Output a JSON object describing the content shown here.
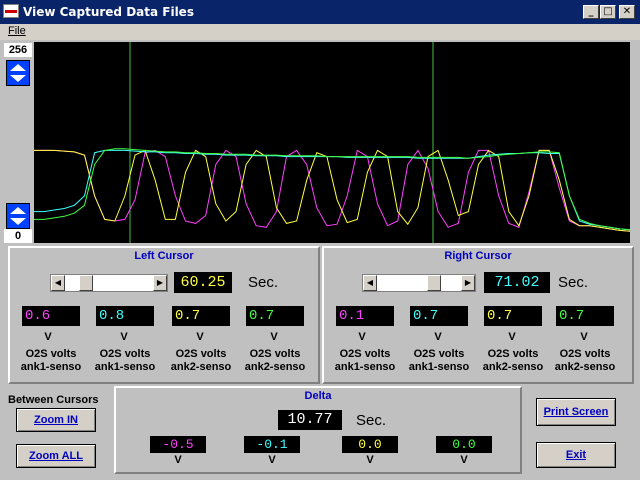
{
  "window": {
    "title": "View Captured Data Files",
    "buttons": {
      "minimize": "_",
      "maximize": "□",
      "close": "✕"
    }
  },
  "menu": {
    "file": "File"
  },
  "scale": {
    "max": "256",
    "min": "0"
  },
  "colors": {
    "sensor1": "#ff40ff",
    "sensor2": "#40ffff",
    "sensor3": "#ffff40",
    "sensor4": "#40ff40",
    "cursor": "#40c040"
  },
  "chart_data": {
    "type": "line",
    "ylim": [
      0,
      256
    ],
    "cursors": {
      "left": 60.25,
      "right": 71.02
    },
    "series": [
      {
        "color": "#ff40ff",
        "values": [
          118,
          118,
          118,
          117,
          116,
          112,
          60,
          30,
          28,
          30,
          55,
          115,
          118,
          110,
          60,
          28,
          25,
          35,
          100,
          118,
          110,
          50,
          22,
          20,
          40,
          110,
          118,
          100,
          45,
          22,
          24,
          60,
          118,
          110,
          50,
          22,
          28,
          100,
          118,
          95,
          40,
          20,
          25,
          90,
          118,
          118,
          60,
          25,
          20,
          65,
          118,
          118,
          70,
          28,
          22,
          22,
          20,
          18,
          16,
          15
        ]
      },
      {
        "color": "#ffff40",
        "values": [
          118,
          118,
          118,
          117,
          116,
          112,
          60,
          30,
          28,
          60,
          112,
          118,
          80,
          30,
          30,
          90,
          118,
          110,
          50,
          28,
          40,
          100,
          118,
          110,
          45,
          25,
          28,
          80,
          115,
          110,
          55,
          26,
          30,
          90,
          118,
          110,
          40,
          24,
          45,
          110,
          118,
          80,
          35,
          40,
          100,
          118,
          110,
          40,
          22,
          60,
          118,
          118,
          80,
          30,
          22,
          22,
          20,
          18,
          16,
          15
        ]
      },
      {
        "color": "#40ffff",
        "values": [
          40,
          40,
          42,
          44,
          48,
          60,
          115,
          118,
          118,
          118,
          117,
          116,
          116,
          115,
          115,
          114,
          114,
          113,
          113,
          112,
          112,
          112,
          111,
          111,
          111,
          110,
          110,
          110,
          110,
          110,
          110,
          109,
          109,
          109,
          109,
          109,
          109,
          109,
          108,
          108,
          108,
          108,
          108,
          108,
          110,
          112,
          113,
          114,
          114,
          115,
          115,
          114,
          114,
          60,
          28,
          24,
          22,
          20,
          18,
          17
        ]
      },
      {
        "color": "#40ff40",
        "values": [
          30,
          30,
          32,
          34,
          38,
          48,
          100,
          118,
          120,
          120,
          119,
          118,
          117,
          116,
          116,
          115,
          115,
          114,
          114,
          113,
          113,
          113,
          112,
          112,
          112,
          111,
          111,
          111,
          111,
          110,
          110,
          110,
          110,
          110,
          110,
          110,
          110,
          110,
          109,
          109,
          109,
          109,
          109,
          108,
          109,
          110,
          112,
          113,
          114,
          115,
          116,
          116,
          115,
          60,
          30,
          25,
          22,
          20,
          18,
          17
        ]
      }
    ]
  },
  "left_cursor": {
    "title": "Left Cursor",
    "seconds": "60.25",
    "sec_label": "Sec.",
    "sensors": [
      {
        "value": "0.6",
        "unit": "V",
        "name": "O2S volts",
        "sub": "ank1-senso"
      },
      {
        "value": "0.8",
        "unit": "V",
        "name": "O2S volts",
        "sub": "ank1-senso"
      },
      {
        "value": "0.7",
        "unit": "V",
        "name": "O2S volts",
        "sub": "ank2-senso"
      },
      {
        "value": "0.7",
        "unit": "V",
        "name": "O2S volts",
        "sub": "ank2-senso"
      }
    ]
  },
  "right_cursor": {
    "title": "Right Cursor",
    "seconds": "71.02",
    "sec_label": "Sec.",
    "sensors": [
      {
        "value": "0.1",
        "unit": "V",
        "name": "O2S volts",
        "sub": "ank1-senso"
      },
      {
        "value": "0.7",
        "unit": "V",
        "name": "O2S volts",
        "sub": "ank1-senso"
      },
      {
        "value": "0.7",
        "unit": "V",
        "name": "O2S volts",
        "sub": "ank2-senso"
      },
      {
        "value": "0.7",
        "unit": "V",
        "name": "O2S volts",
        "sub": "ank2-senso"
      }
    ]
  },
  "between": {
    "label": "Between Cursors",
    "zoom_in": "Zoom IN",
    "zoom_all": "Zoom ALL"
  },
  "delta": {
    "title": "Delta",
    "seconds": "10.77",
    "sec_label": "Sec.",
    "values": [
      {
        "value": "-0.5",
        "unit": "V"
      },
      {
        "value": "-0.1",
        "unit": "V"
      },
      {
        "value": "0.0",
        "unit": "V"
      },
      {
        "value": "0.0",
        "unit": "V"
      }
    ]
  },
  "buttons": {
    "print_screen": "Print Screen",
    "exit": "Exit"
  }
}
